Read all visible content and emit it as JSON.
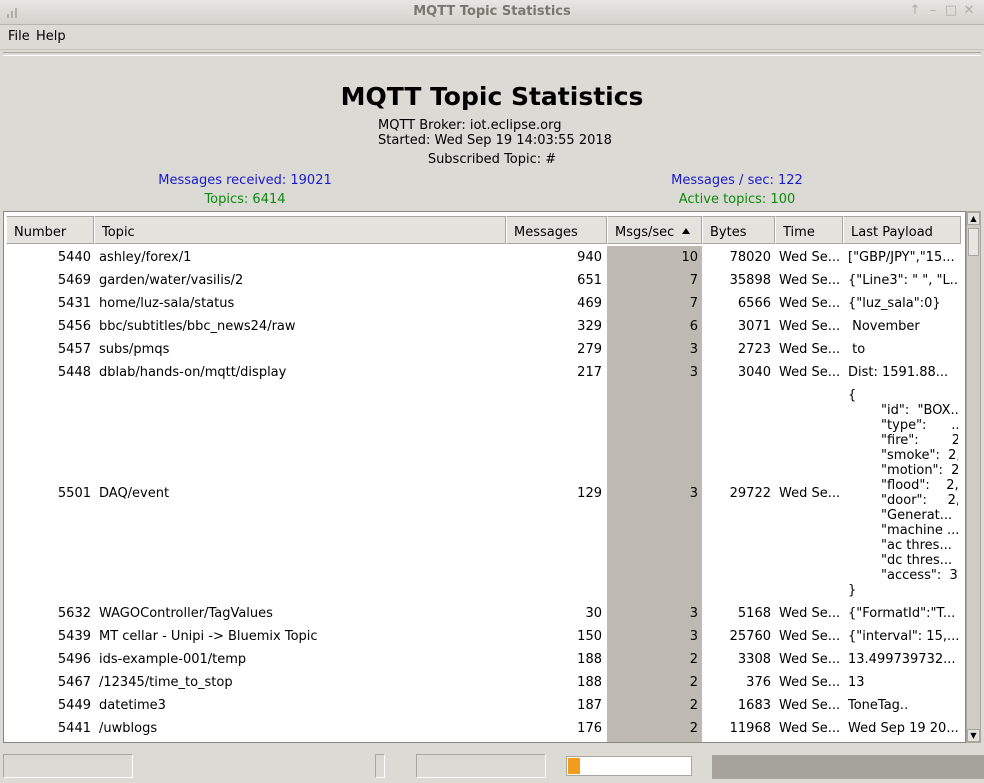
{
  "window": {
    "title": "MQTT Topic Statistics"
  },
  "menu": {
    "file": "File",
    "help": "Help"
  },
  "header": {
    "title": "MQTT Topic Statistics",
    "broker": "MQTT Broker: iot.eclipse.org",
    "started": "Started: Wed Sep 19 14:03:55 2018",
    "subscribed": "Subscribed Topic: #",
    "messages_received": "Messages received: 19021",
    "messages_per_sec": "Messages / sec: 122",
    "topics": "Topics: 6414",
    "active_topics": "Active topics: 100"
  },
  "colors": {
    "blue": "#1a1acd",
    "green": "#0e8a0e",
    "sorted_column": "#bebab3",
    "progress": "#f39b1d"
  },
  "table": {
    "columns": [
      "Number",
      "Topic",
      "Messages",
      "Msgs/sec",
      "Bytes",
      "Time",
      "Last Payload"
    ],
    "sort_column": "Msgs/sec",
    "sort_direction": "descending",
    "rows": [
      {
        "number": "5440",
        "topic": "ashley/forex/1",
        "messages": "940",
        "rate": "10",
        "bytes": "78020",
        "time": "Wed Se...",
        "payload": "[\"GBP/JPY\",\"15..."
      },
      {
        "number": "5469",
        "topic": "garden/water/vasilis/2",
        "messages": "651",
        "rate": "7",
        "bytes": "35898",
        "time": "Wed Se...",
        "payload": "{\"Line3\": \" \", \"L..."
      },
      {
        "number": "5431",
        "topic": "home/luz-sala/status",
        "messages": "469",
        "rate": "7",
        "bytes": "6566",
        "time": "Wed Se...",
        "payload": "{\"luz_sala\":0}"
      },
      {
        "number": "5456",
        "topic": "bbc/subtitles/bbc_news24/raw",
        "messages": "329",
        "rate": "6",
        "bytes": "3071",
        "time": "Wed Se...",
        "payload": " November"
      },
      {
        "number": "5457",
        "topic": "subs/pmqs",
        "messages": "279",
        "rate": "3",
        "bytes": "2723",
        "time": "Wed Se...",
        "payload": " to"
      },
      {
        "number": "5448",
        "topic": "dblab/hands-on/mqtt/display",
        "messages": "217",
        "rate": "3",
        "bytes": "3040",
        "time": "Wed Se...",
        "payload": "Dist: 1591.88..."
      },
      {
        "number": "5501",
        "topic": "DAQ/event",
        "messages": "129",
        "rate": "3",
        "bytes": "29722",
        "time": "Wed Se...",
        "payload": "{\n        \"id\":  \"BOX...\n        \"type\":      ...\n        \"fire\":        2,\n        \"smoke\":  2,\n        \"motion\":  2,\n        \"flood\":    2,\n        \"door\":     2,\n        \"Generat...\n        \"machine ...\n        \"ac thres...\n        \"dc thres...\n        \"access\":  3\n}"
      },
      {
        "number": "5632",
        "topic": "WAGOController/TagValues",
        "messages": "30",
        "rate": "3",
        "bytes": "5168",
        "time": "Wed Se...",
        "payload": "{\"FormatId\":\"T..."
      },
      {
        "number": "5439",
        "topic": "MT cellar - Unipi -> Bluemix Topic",
        "messages": "150",
        "rate": "3",
        "bytes": "25760",
        "time": "Wed Se...",
        "payload": "{\"interval\": 15,..."
      },
      {
        "number": "5496",
        "topic": "ids-example-001/temp",
        "messages": "188",
        "rate": "2",
        "bytes": "3308",
        "time": "Wed Se...",
        "payload": "13.499739732..."
      },
      {
        "number": "5467",
        "topic": "/12345/time_to_stop",
        "messages": "188",
        "rate": "2",
        "bytes": "376",
        "time": "Wed Se...",
        "payload": "13"
      },
      {
        "number": "5449",
        "topic": "datetime3",
        "messages": "187",
        "rate": "2",
        "bytes": "1683",
        "time": "Wed Se...",
        "payload": "ToneTag.."
      },
      {
        "number": "5441",
        "topic": "/uwblogs",
        "messages": "176",
        "rate": "2",
        "bytes": "11968",
        "time": "Wed Se...",
        "payload": "Wed Sep 19 20..."
      }
    ]
  },
  "status": {
    "progress": 0.1
  }
}
